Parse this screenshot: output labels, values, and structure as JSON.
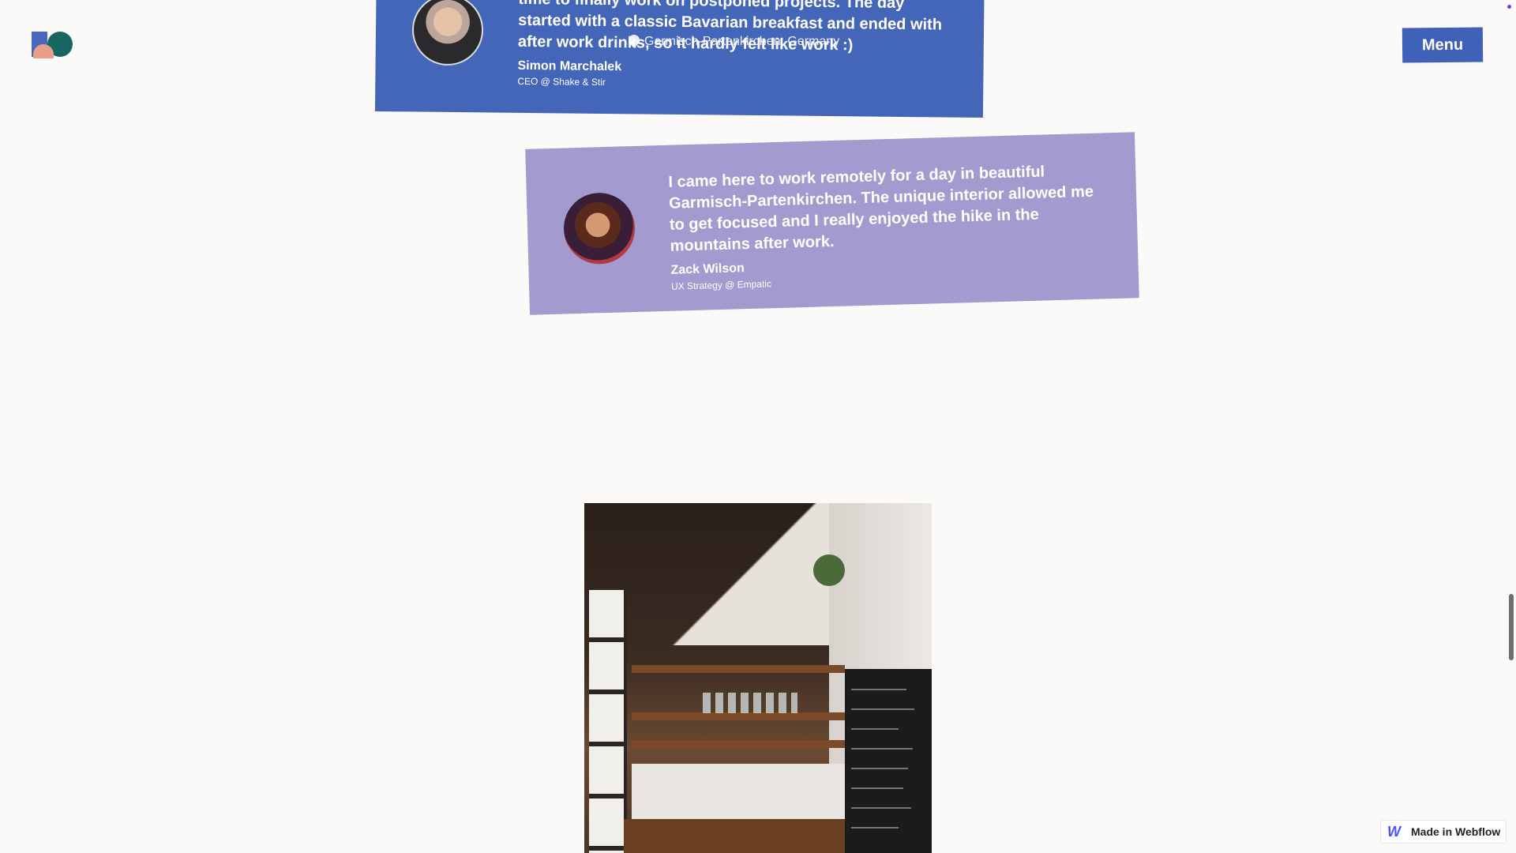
{
  "header": {
    "logo_name": "brand-logo",
    "menu_label": "Menu"
  },
  "location": {
    "text": "Garmisch-Partenkirchen, Germany"
  },
  "testimonials": [
    {
      "quote": "time to finally work on postponed projects. The day started with a classic Bavarian breakfast and ended with after work drinks, so it hardly felt like work :)",
      "name": "Simon Marchalek",
      "role": "CEO @ Shake & Stir",
      "color": "#4466b8"
    },
    {
      "quote": "I came here to work remotely for a day in beautiful Garmisch-Partenkirchen. The unique interior allowed me to get focused and I really enjoyed the hike in the mountains after work.",
      "name": "Zack Wilson",
      "role": "UX Strategy @ Empatic",
      "color": "#a39ad0"
    }
  ],
  "badge": {
    "label": "Made in Webflow"
  },
  "colors": {
    "accent": "#3f61b7",
    "background": "#fcfaf8"
  }
}
